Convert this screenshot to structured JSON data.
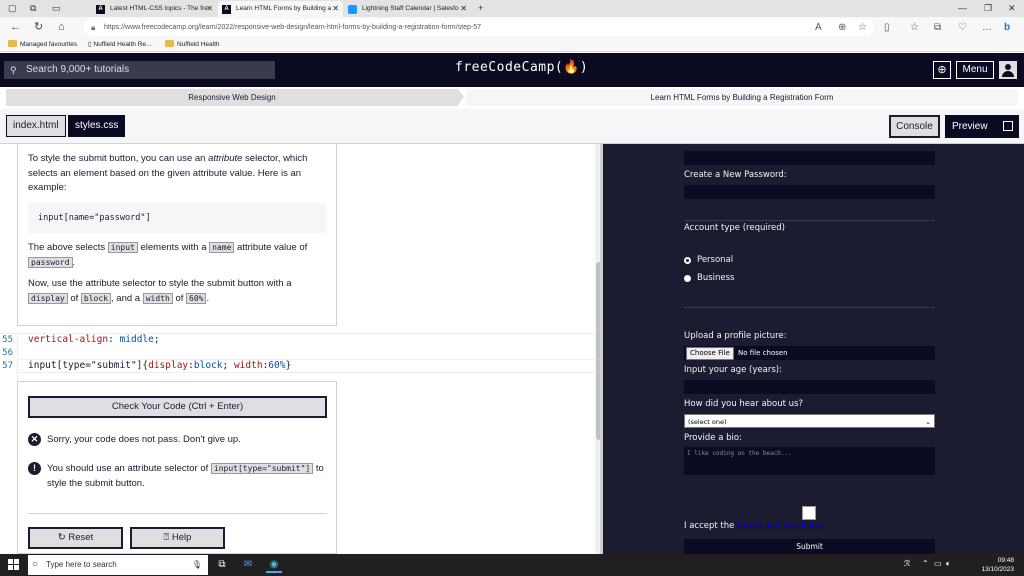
{
  "browser": {
    "tabs": [
      {
        "label": "Latest HTML-CSS topics - The fre",
        "active": false
      },
      {
        "label": "Learn HTML Forms by Building a",
        "active": true
      },
      {
        "label": "Lightning Staff Calendar | Salesfo",
        "active": false
      }
    ],
    "new_tab": "+",
    "url": "https://www.freecodecamp.org/learn/2022/responsive-web-design/learn-html-forms-by-building-a-registration-form/step-57",
    "favourites": [
      "Managed favourites",
      "Nuffield Health Re...",
      "Nuffield Health"
    ]
  },
  "fcc": {
    "search_placeholder": "Search 9,000+ tutorials",
    "logo": "freeCodeCamp(🔥)",
    "menu": "Menu"
  },
  "breadcrumb": {
    "section": "Responsive Web Design",
    "lesson": "Learn HTML Forms by Building a Registration Form"
  },
  "files": {
    "tab1": "index.html",
    "tab2": "styles.css",
    "console": "Console",
    "preview": "Preview"
  },
  "instructions": {
    "p1_a": "To style the submit button, you can use an ",
    "p1_em": "attribute",
    "p1_b": " selector, which selects an element based on the given attribute value. Here is an example:",
    "code": "input[name=\"password\"]",
    "p2_a": "The above selects ",
    "p2_code1": "input",
    "p2_b": " elements with a ",
    "p2_code2": "name",
    "p2_c": " attribute value of ",
    "p2_code3": "password",
    "p2_d": ".",
    "p3_a": "Now, use the attribute selector to style the submit button with a ",
    "p3_code1": "display",
    "p3_b": " of ",
    "p3_code2": "block",
    "p3_c": ", and a ",
    "p3_code3": "width",
    "p3_d": " of ",
    "p3_code4": "60%",
    "p3_e": "."
  },
  "editor": {
    "lines": [
      {
        "num": "55",
        "prop": "vertical-align",
        "val": "middle"
      },
      {
        "num": "56"
      },
      {
        "num": "57",
        "selector": "input[type=\"submit\"]{",
        "p1": "display",
        "v1": "block",
        "p2": "width",
        "v2": "60%",
        "end": "}"
      }
    ]
  },
  "results": {
    "check": "Check Your Code (Ctrl + Enter)",
    "fail": "Sorry, your code does not pass. Don't give up.",
    "hint_a": "You should use an attribute selector of ",
    "hint_code": "input[type=\"submit\"]",
    "hint_b": " to style the submit button.",
    "reset": "Reset",
    "help": "Help"
  },
  "preview": {
    "create_password": "Create a New Password:",
    "account_type": "Account type (required)",
    "personal": "Personal",
    "business": "Business",
    "upload": "Upload a profile picture:",
    "choose_file": "Choose File",
    "no_file": "No file chosen",
    "age": "Input your age (years):",
    "hear": "How did you hear about us?",
    "select_value": "(select one)",
    "bio": "Provide a bio:",
    "bio_placeholder": "I like coding on the beach...",
    "accept": "I accept the ",
    "terms_link": "terms and conditions",
    "submit": "Submit"
  },
  "taskbar": {
    "search": "Type here to search",
    "time": "09:48",
    "date": "13/10/2023"
  }
}
